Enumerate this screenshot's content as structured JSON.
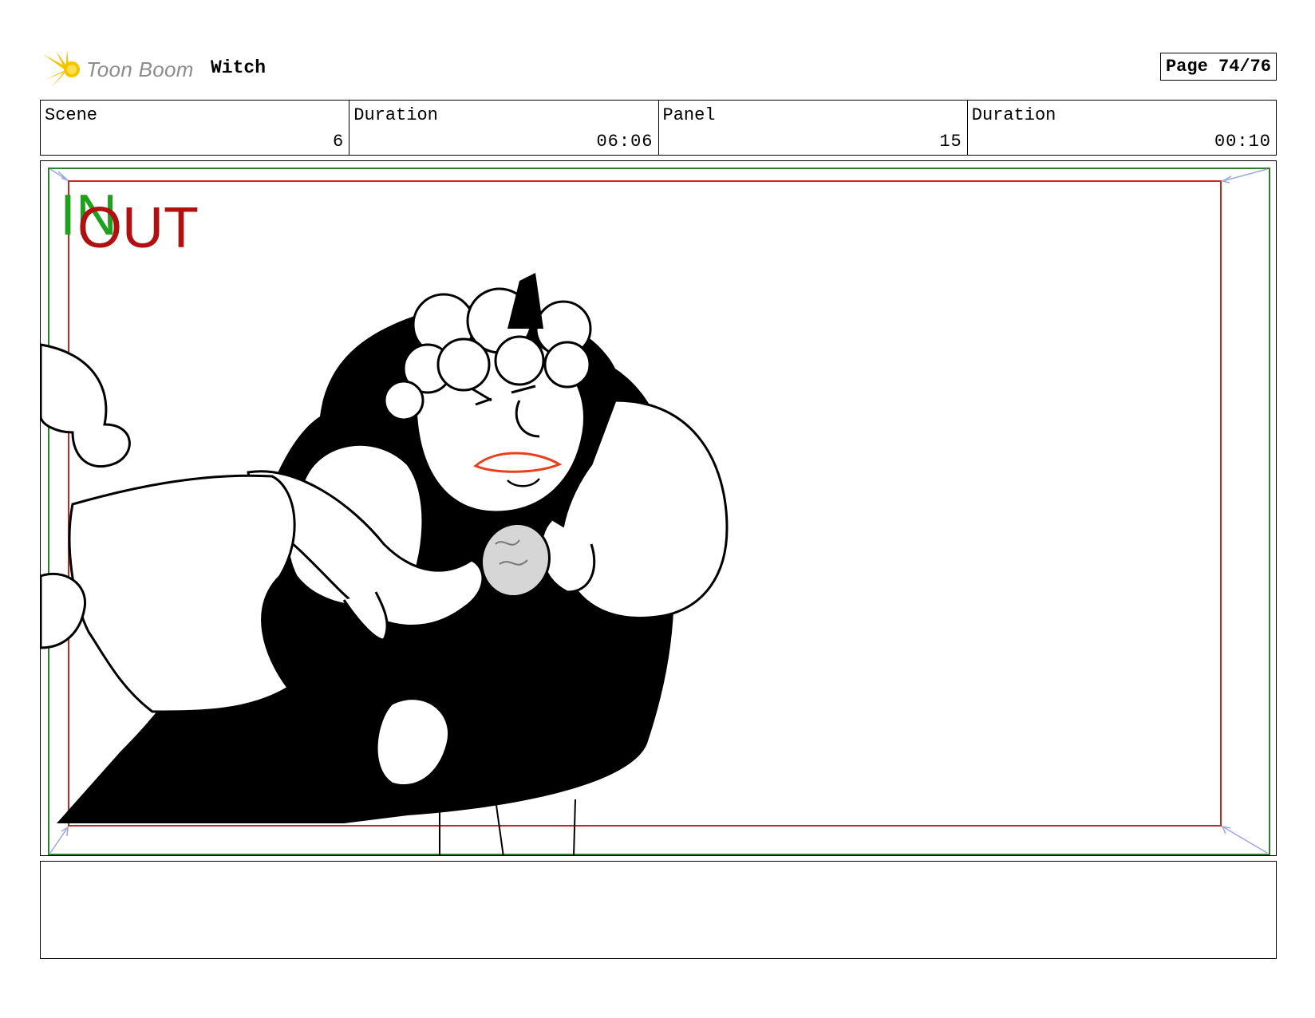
{
  "header": {
    "brand": "Toon Boom",
    "project_title": "Witch",
    "page_label": "Page 74/76"
  },
  "info": [
    {
      "label": "Scene",
      "value": "6"
    },
    {
      "label": "Duration",
      "value": "06:06"
    },
    {
      "label": "Panel",
      "value": "15"
    },
    {
      "label": "Duration",
      "value": "00:10"
    }
  ],
  "panel": {
    "in_marker": "IN",
    "out_marker": "OUT"
  },
  "colors": {
    "in_marker": "#1fa01f",
    "out_marker": "#b01010",
    "safe_frame_green": "#2e7d32",
    "safe_frame_red": "#c62828",
    "logo_star": "#f5c400",
    "lip_color": "#e8401c"
  },
  "notes": {
    "text": ""
  }
}
